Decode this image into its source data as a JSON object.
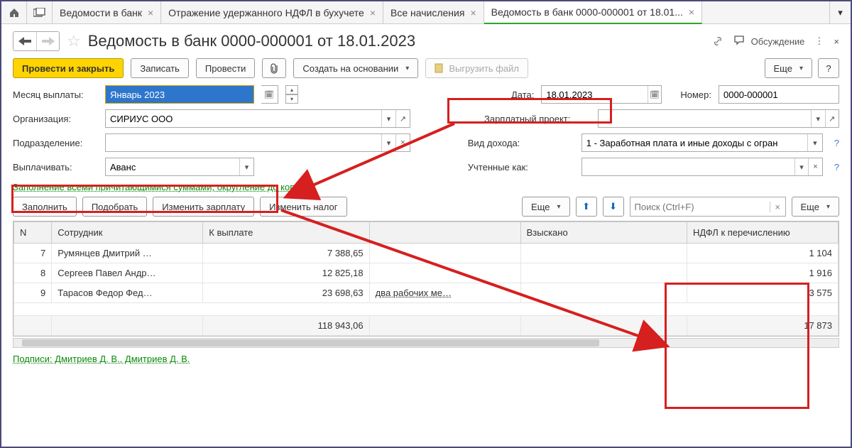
{
  "tabs": [
    {
      "label": "Ведомости в банк"
    },
    {
      "label": "Отражение удержанного НДФЛ в бухучете"
    },
    {
      "label": "Все начисления"
    },
    {
      "label": "Ведомость в банк 0000-000001 от 18.01...",
      "active": true
    }
  ],
  "title": "Ведомость в банк 0000-000001 от 18.01.2023",
  "discussion_label": "Обсуждение",
  "toolbar": {
    "post_and_close": "Провести и закрыть",
    "save": "Записать",
    "post": "Провести",
    "create_based": "Создать на основании",
    "export_file": "Выгрузить файл",
    "more": "Еще"
  },
  "form": {
    "month_label": "Месяц выплаты:",
    "month_value": "Январь 2023",
    "date_label": "Дата:",
    "date_value": "18.01.2023",
    "number_label": "Номер:",
    "number_value": "0000-000001",
    "org_label": "Организация:",
    "org_value": "СИРИУС ООО",
    "proj_label": "Зарплатный проект:",
    "proj_value": "",
    "division_label": "Подразделение:",
    "division_value": "",
    "incometype_label": "Вид дохода:",
    "incometype_value": "1 - Заработная плата и иные доходы с огран",
    "pay_label": "Выплачивать:",
    "pay_value": "Аванс",
    "accounted_label": "Учтенные как:",
    "accounted_value": "",
    "hint_link": "Заполнение всеми причитающимися суммами, округление до копейки"
  },
  "tbl_toolbar": {
    "fill": "Заполнить",
    "pick": "Подобрать",
    "change_salary": "Изменить зарплату",
    "change_tax": "Изменить налог",
    "more": "Еще",
    "search_placeholder": "Поиск (Ctrl+F)"
  },
  "columns": {
    "n": "N",
    "employee": "Сотрудник",
    "to_pay": "К выплате",
    "collected": "Взыскано",
    "tax": "НДФЛ к перечислению"
  },
  "rows": [
    {
      "n": "7",
      "employee": "Румянцев Дмитрий …",
      "to_pay": "7 388,65",
      "extra": "",
      "collected": "",
      "tax": "1 104"
    },
    {
      "n": "8",
      "employee": "Сергеев Павел Андр…",
      "to_pay": "12 825,18",
      "extra": "",
      "collected": "",
      "tax": "1 916"
    },
    {
      "n": "9",
      "employee": "Тарасов Федор Фед…",
      "to_pay": "23 698,63",
      "extra": "два рабочих ме…",
      "collected": "",
      "tax": "3 575"
    }
  ],
  "totals": {
    "to_pay": "118 943,06",
    "tax": "17 873"
  },
  "footer": "Подписи: Дмитриев Д. В., Дмитриев Д. В."
}
